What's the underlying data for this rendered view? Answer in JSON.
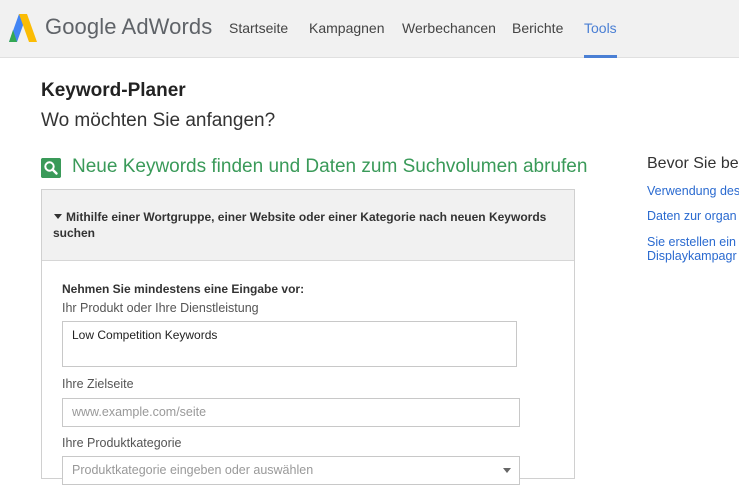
{
  "brand": {
    "name": "Google AdWords",
    "colors": {
      "blue": "#4285f4",
      "green": "#34a853",
      "yellow": "#fbbc05"
    }
  },
  "nav": {
    "items": [
      {
        "label": "Startseite",
        "active": false
      },
      {
        "label": "Kampagnen",
        "active": false
      },
      {
        "label": "Werbechancen",
        "active": false
      },
      {
        "label": "Berichte",
        "active": false
      },
      {
        "label": "Tools",
        "active": true
      }
    ],
    "active_color": "#4a7fd4"
  },
  "page": {
    "title": "Keyword-Planer",
    "subtitle": "Wo möchten Sie anfangen?"
  },
  "section": {
    "icon": "magnifier-icon",
    "title": "Neue Keywords finden und Daten zum Suchvolumen abrufen",
    "color": "#3a9a59"
  },
  "panel": {
    "header": "Mithilfe einer Wortgruppe, einer Website oder einer Kategorie nach neuen Keywords suchen",
    "intro": "Nehmen Sie mindestens eine Eingabe vor:",
    "product_label": "Ihr Produkt oder Ihre Dienstleistung",
    "product_value": "Low Competition Keywords",
    "landing_label": "Ihre Zielseite",
    "landing_placeholder": "www.example.com/seite",
    "category_label": "Ihre Produktkategorie",
    "category_placeholder": "Produktkategorie eingeben oder auswählen"
  },
  "sidebar": {
    "title": "Bevor Sie be",
    "links": [
      {
        "label": "Verwendung des"
      },
      {
        "label": "Daten zur organ"
      },
      {
        "label": "Sie erstellen ein"
      },
      {
        "label": "Displaykampagr"
      }
    ]
  }
}
